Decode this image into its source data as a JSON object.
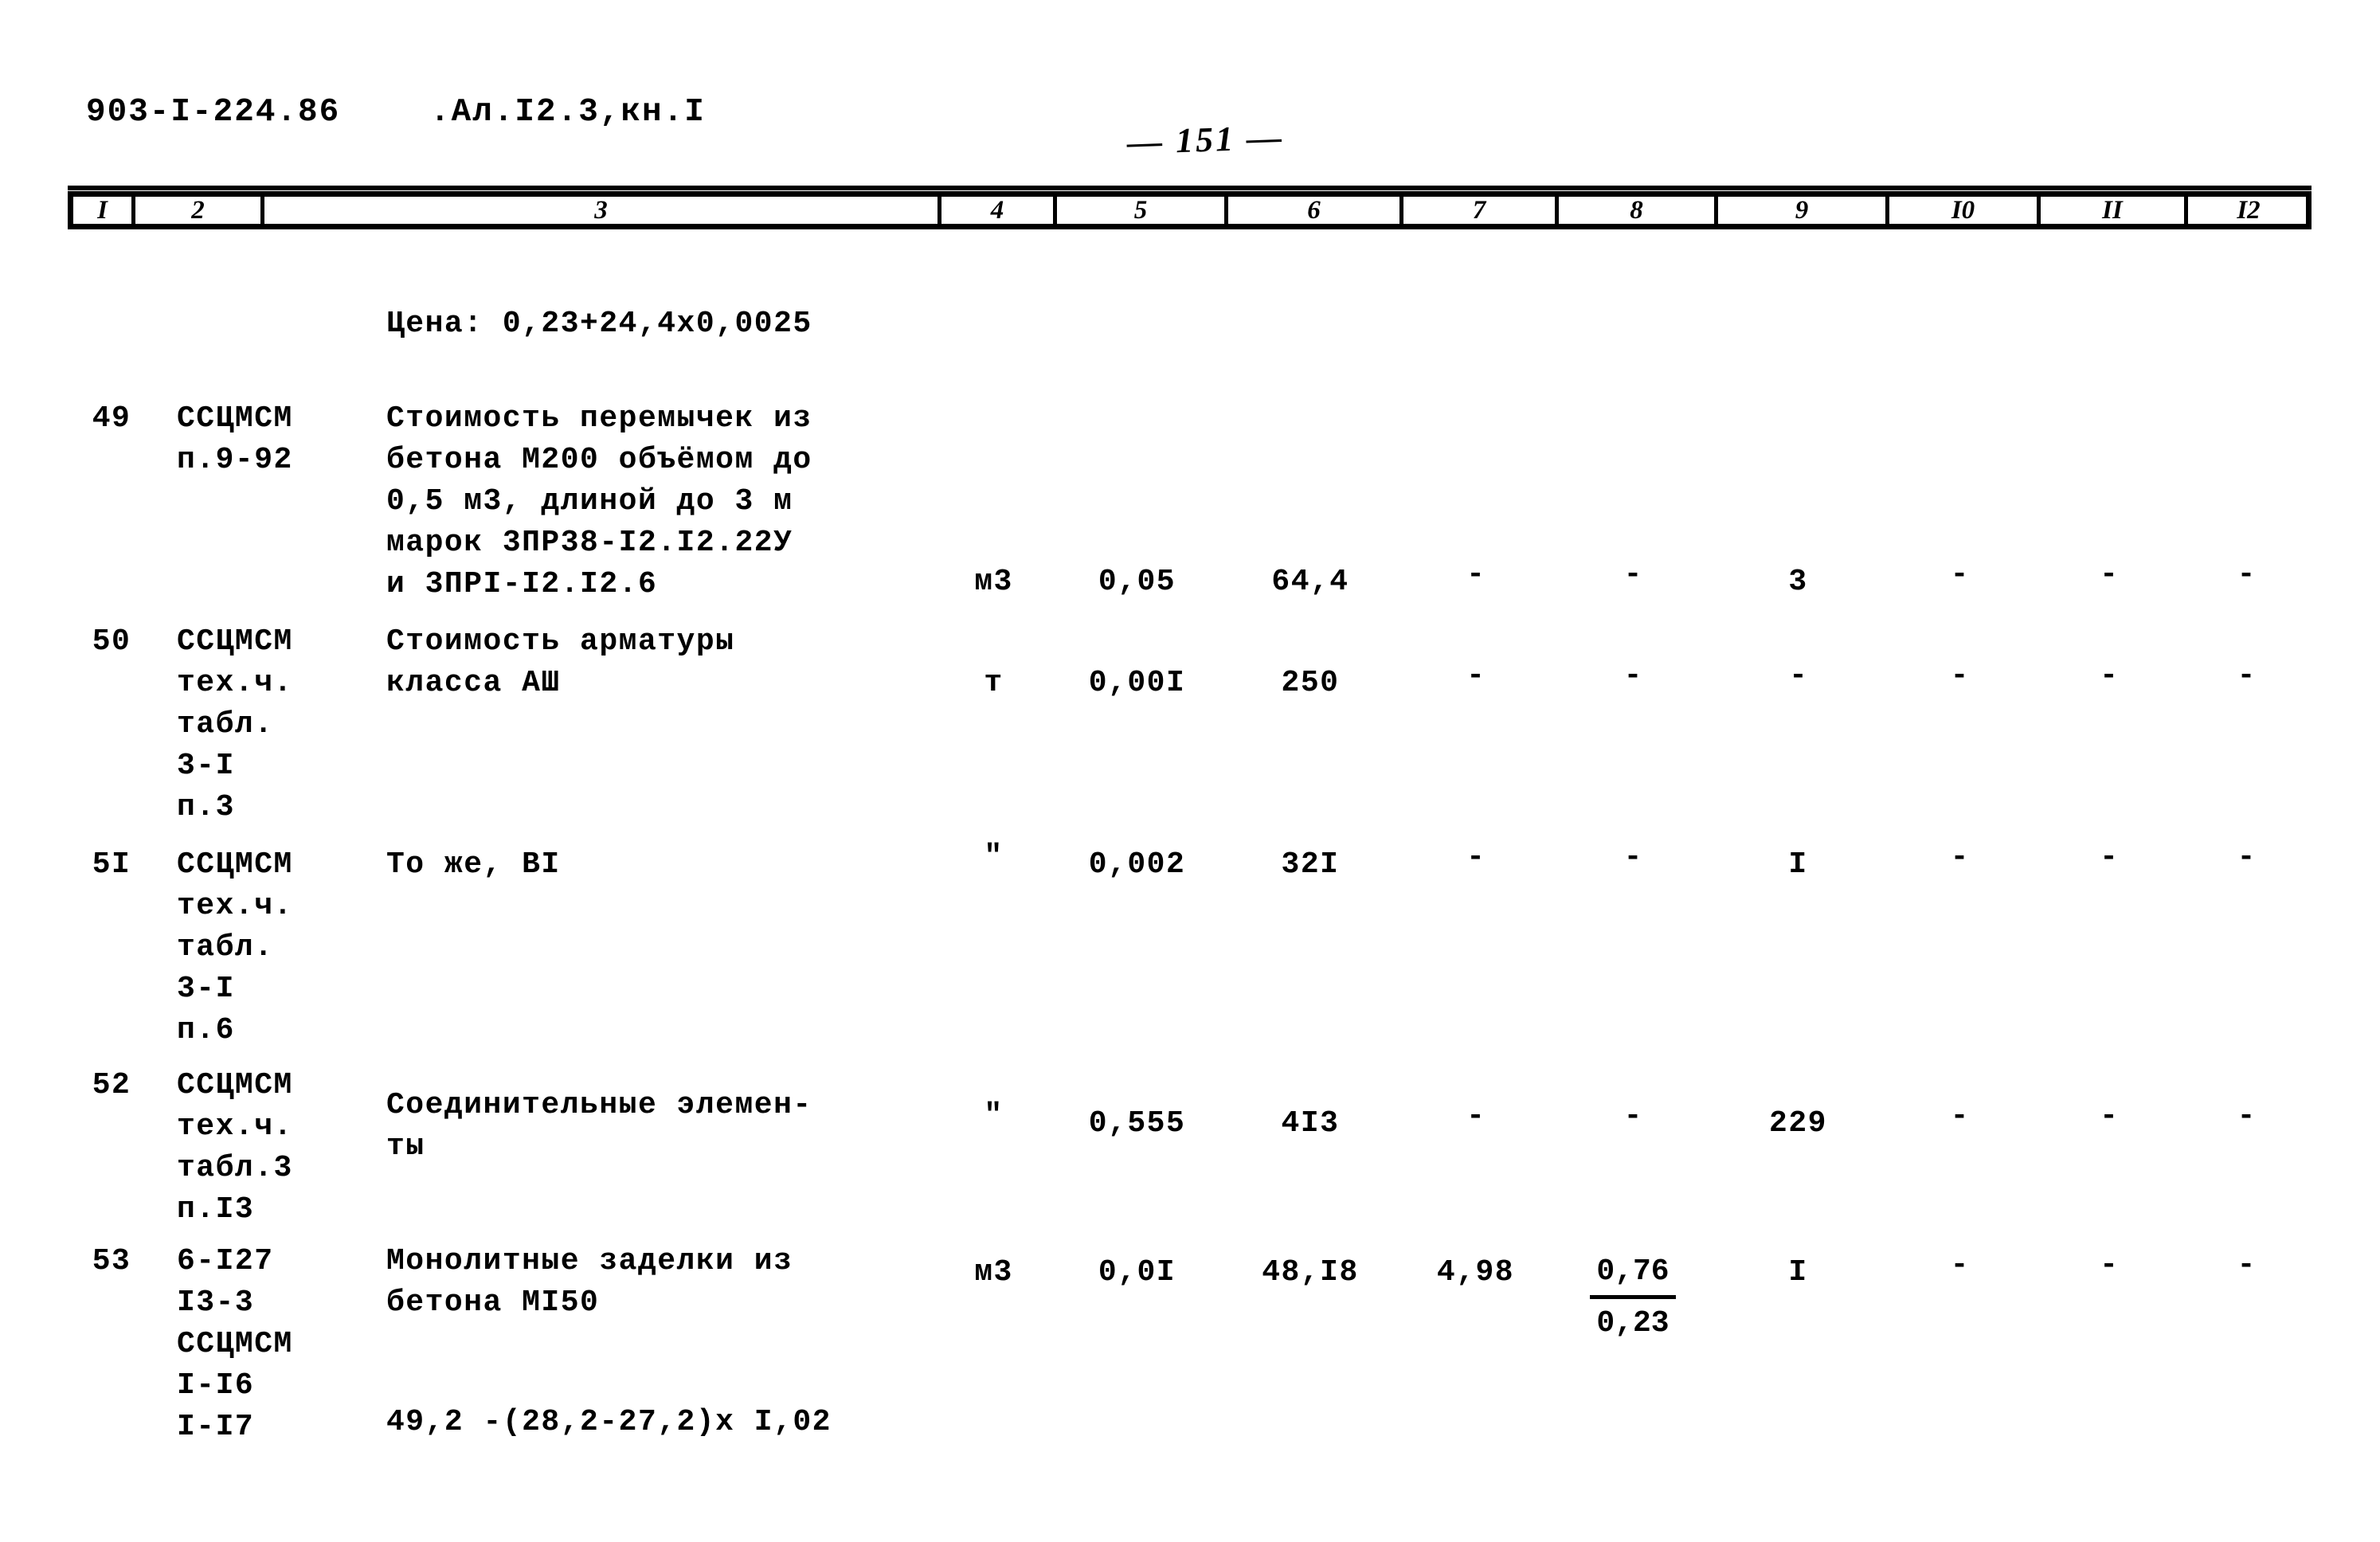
{
  "header": {
    "doc_code": "903-I-224.86",
    "album": ".Ал.I2.3,кн.I",
    "page_number": "— 151 —"
  },
  "table": {
    "column_headers": [
      "I",
      "2",
      "3",
      "4",
      "5",
      "6",
      "7",
      "8",
      "9",
      "I0",
      "II",
      "I2"
    ],
    "price_note": "Цена:  0,23+24,4х0,0025",
    "rows": [
      {
        "num": "49",
        "code": "ССЦМСМ\nп.9-92",
        "description": "Стоимость перемычек из\nбетона М200 объёмом до\n0,5 м3, длиной до 3 м\nмарок 3ПР38-I2.I2.22У\nи 3ПРI-I2.I2.6",
        "unit": "м3",
        "c5": "0,05",
        "c6": "64,4",
        "c7": "-",
        "c8": "-",
        "c9": "3",
        "c10": "-",
        "c11": "-",
        "c12": "-"
      },
      {
        "num": "50",
        "code": "ССЦМСМ\nтех.ч.\nтабл.\n3-I\nп.3",
        "description": "Стоимость арматуры\nкласса АШ",
        "unit": "т",
        "c5": "0,00I",
        "c6": "250",
        "c7": "-",
        "c8": "-",
        "c9": "-",
        "c10": "-",
        "c11": "-",
        "c12": "-"
      },
      {
        "num": "5I",
        "code": "ССЦМСМ\nтех.ч.\nтабл.\n3-I\nп.6",
        "description": "То же, ВI",
        "unit": "\"",
        "c5": "0,002",
        "c6": "32I",
        "c7": "-",
        "c8": "-",
        "c9": "I",
        "c10": "-",
        "c11": "-",
        "c12": "-"
      },
      {
        "num": "52",
        "code": "ССЦМСМ\nтех.ч.\nтабл.3\nп.I3",
        "description": "Соединительные элемен-\nты",
        "unit": "\"",
        "c5": "0,555",
        "c6": "4I3",
        "c7": "-",
        "c8": "-",
        "c9": "229",
        "c10": "-",
        "c11": "-",
        "c12": "-"
      },
      {
        "num": "53",
        "code": "6-I27\nI3-3\nССЦМСМ\nI-I6\nI-I7",
        "description": "Монолитные заделки из\nбетона МI50",
        "formula": "49,2 -(28,2-27,2)х I,02",
        "unit": "м3",
        "c5": "0,0I",
        "c6": "48,I8",
        "c7": "4,98",
        "c8_top": "0,76",
        "c8_bottom": "0,23",
        "c9": "I",
        "c10": "-",
        "c11": "-",
        "c12": "-"
      }
    ]
  }
}
